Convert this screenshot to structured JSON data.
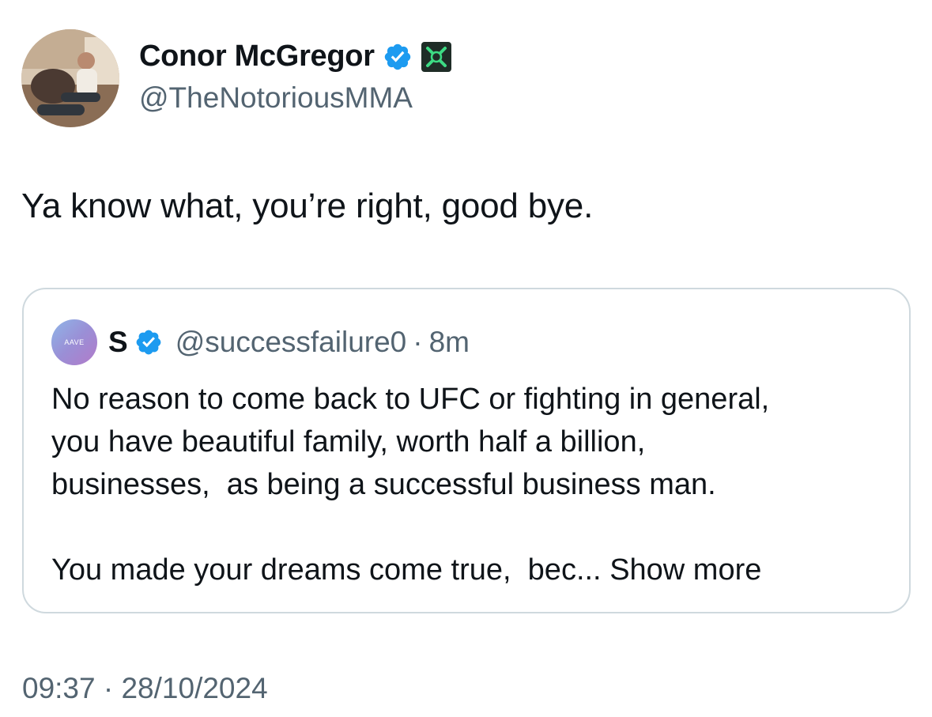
{
  "author": {
    "name": "Conor McGregor",
    "handle": "@TheNotoriousMMA",
    "verified_color": "#1d9bf0"
  },
  "tweet": {
    "text": "Ya know what, you’re right, good bye."
  },
  "quoted": {
    "avatar_text": "AAVE",
    "name": "S",
    "handle": "@successfailure0",
    "separator": "·",
    "time": "8m",
    "lines": [
      "No reason to come back to UFC or fighting in general,",
      "you have beautiful family, worth half a billion,",
      "businesses,  as being a successful business man."
    ],
    "last_line": "You made your dreams come true,  bec...",
    "show_more": "Show more"
  },
  "meta": {
    "time": "09:37",
    "separator": "·",
    "date": "28/10/2024"
  },
  "colors": {
    "text": "#0f1419",
    "secondary": "#536471",
    "border": "#cfd9de",
    "verified": "#1d9bf0",
    "affiliation_bg": "#1f2d27",
    "affiliation_fg": "#3ddc84"
  }
}
